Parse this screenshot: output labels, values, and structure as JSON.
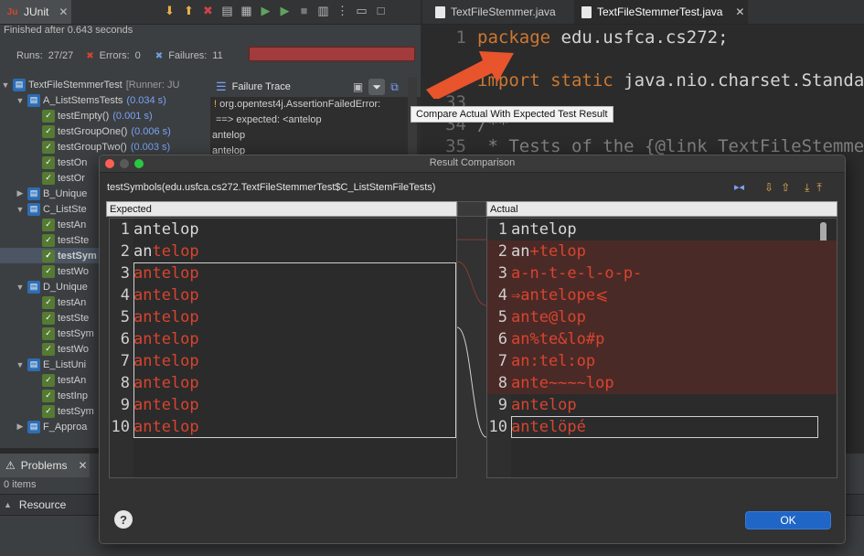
{
  "junit": {
    "tab_label": "JUnit",
    "summary": "Finished after 0.643 seconds",
    "runs_label": "Runs:",
    "runs_value": "27/27",
    "errors_label": "Errors:",
    "errors_value": "0",
    "failures_label": "Failures:",
    "failures_value": "11",
    "tree": [
      {
        "label": "TextFileStemmerTest",
        "suffix": "[Runner: JU",
        "level": 0,
        "kind": "root",
        "expanded": true
      },
      {
        "label": "A_ListStemsTests",
        "time": "(0.034 s)",
        "level": 1,
        "kind": "f",
        "expanded": true
      },
      {
        "label": "testEmpty()",
        "time": "(0.001 s)",
        "level": 2,
        "kind": "t"
      },
      {
        "label": "testGroupOne()",
        "time": "(0.006 s)",
        "level": 2,
        "kind": "t"
      },
      {
        "label": "testGroupTwo()",
        "time": "(0.003 s)",
        "level": 2,
        "kind": "t"
      },
      {
        "label": "testOn",
        "level": 2,
        "kind": "t"
      },
      {
        "label": "testOr",
        "level": 2,
        "kind": "t"
      },
      {
        "label": "B_Unique",
        "level": 1,
        "kind": "f",
        "expanded": false
      },
      {
        "label": "C_ListSte",
        "level": 1,
        "kind": "f",
        "expanded": true
      },
      {
        "label": "testAn",
        "level": 2,
        "kind": "t"
      },
      {
        "label": "testSte",
        "level": 2,
        "kind": "t"
      },
      {
        "label": "testSym",
        "level": 2,
        "kind": "t",
        "selected": true
      },
      {
        "label": "testWo",
        "level": 2,
        "kind": "t"
      },
      {
        "label": "D_Unique",
        "level": 1,
        "kind": "f",
        "expanded": true
      },
      {
        "label": "testAn",
        "level": 2,
        "kind": "t"
      },
      {
        "label": "testSte",
        "level": 2,
        "kind": "t"
      },
      {
        "label": "testSym",
        "level": 2,
        "kind": "t"
      },
      {
        "label": "testWo",
        "level": 2,
        "kind": "t"
      },
      {
        "label": "E_ListUni",
        "level": 1,
        "kind": "f",
        "expanded": true
      },
      {
        "label": "testAn",
        "level": 2,
        "kind": "t"
      },
      {
        "label": "testInp",
        "level": 2,
        "kind": "t"
      },
      {
        "label": "testSym",
        "level": 2,
        "kind": "t"
      },
      {
        "label": "F_Approa",
        "level": 1,
        "kind": "f",
        "expanded": false
      }
    ],
    "failure_trace_label": "Failure Trace",
    "trace_lines": [
      "org.opentest4j.AssertionFailedError:",
      "==> expected: <antelop",
      "antelop",
      "antelop"
    ],
    "tooltip": "Compare Actual With Expected Test Result"
  },
  "editor": {
    "tabs": [
      {
        "label": "TextFileStemmer.java",
        "active": false
      },
      {
        "label": "TextFileStemmerTest.java",
        "active": true
      }
    ],
    "lines": [
      {
        "num": "1",
        "parts": [
          {
            "t": "package ",
            "c": "kw"
          },
          {
            "t": "edu.usfca.cs272;",
            "c": "id"
          }
        ]
      },
      {
        "num": "3",
        "parts": [
          {
            "t": "import static ",
            "c": "kw"
          },
          {
            "t": "java.nio.charset.StandardC",
            "c": "id"
          }
        ]
      },
      {
        "num": "33",
        "parts": []
      },
      {
        "num": "34",
        "parts": [
          {
            "t": "/**",
            "c": "cm"
          }
        ]
      },
      {
        "num": "35",
        "parts": [
          {
            "t": " * Tests of the {@link TextFileStemmer}",
            "c": "cm"
          }
        ]
      }
    ]
  },
  "problems": {
    "tab_label": "Problems",
    "count": "0 items",
    "column": "Resource"
  },
  "dialog": {
    "title": "Result Comparison",
    "subtitle": "testSymbols(edu.usfca.cs272.TextFileStemmerTest$C_ListStemFileTests)",
    "expected_label": "Expected",
    "actual_label": "Actual",
    "expected": [
      {
        "n": "1",
        "text": "antelop",
        "diff": false
      },
      {
        "n": "2",
        "text": "antelop",
        "diff": "partial",
        "same": "an",
        "changed": "telop"
      },
      {
        "n": "3",
        "text": "antelop",
        "diff": true
      },
      {
        "n": "4",
        "text": "antelop",
        "diff": true
      },
      {
        "n": "5",
        "text": "antelop",
        "diff": true
      },
      {
        "n": "6",
        "text": "antelop",
        "diff": true
      },
      {
        "n": "7",
        "text": "antelop",
        "diff": true
      },
      {
        "n": "8",
        "text": "antelop",
        "diff": true
      },
      {
        "n": "9",
        "text": "antelop",
        "diff": true
      },
      {
        "n": "10",
        "text": "antelop",
        "diff": true
      }
    ],
    "actual": [
      {
        "n": "1",
        "text": "antelop",
        "diff": false
      },
      {
        "n": "2",
        "text": "an+telop",
        "diff": "partial",
        "same": "an",
        "changed": "+telop"
      },
      {
        "n": "3",
        "text": "a-n-t-e-l-o-p-",
        "diff": true
      },
      {
        "n": "4",
        "text": "⇒antelope⩽",
        "diff": true
      },
      {
        "n": "5",
        "text": "ante@lop",
        "diff": true
      },
      {
        "n": "6",
        "text": "an%te&lo#p",
        "diff": true
      },
      {
        "n": "7",
        "text": "an:tel:op",
        "diff": true
      },
      {
        "n": "8",
        "text": "ante~~~~lop",
        "diff": true
      },
      {
        "n": "9",
        "text": "antelop",
        "diff": true
      },
      {
        "n": "10",
        "text": "antelöpé",
        "diff": true
      }
    ],
    "ok_label": "OK",
    "help_label": "?"
  },
  "colors": {
    "accent": "#1f66c7",
    "diff_text": "#d9442f",
    "failure_bar": "#a23b3b",
    "arrow": "#e8542c"
  }
}
